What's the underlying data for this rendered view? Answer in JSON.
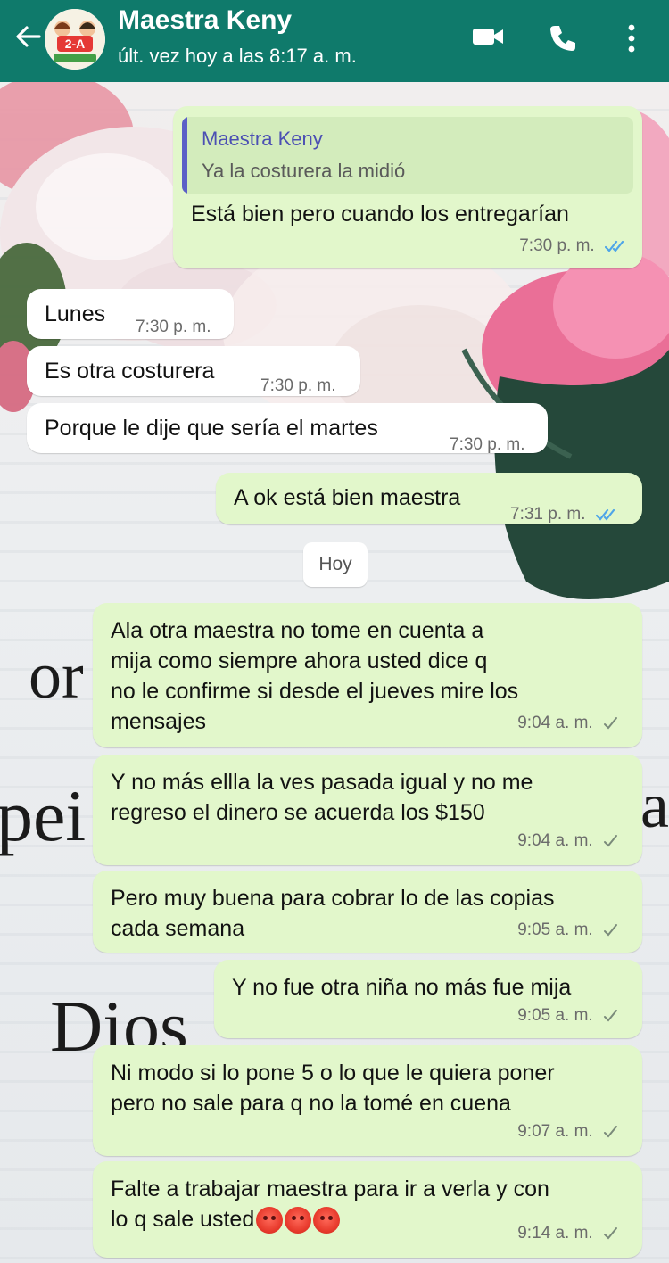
{
  "header": {
    "contact_name": "Maestra Keny",
    "last_seen": "últ. vez hoy a las 8:17 a. m.",
    "icons": [
      "back-arrow-icon",
      "video-call-icon",
      "phone-icon",
      "more-vert-icon"
    ],
    "avatar_text": "2-A"
  },
  "colors": {
    "header": "#0f7a6b",
    "outgoing_bubble": "#e2f7cb",
    "incoming_bubble": "#ffffff",
    "read_ticks": "#4fa5e8",
    "sent_tick": "#7a8a7a"
  },
  "date_chip": "Hoy",
  "messages": [
    {
      "direction": "out",
      "quote": {
        "author": "Maestra Keny",
        "text": "Ya la costurera la midió"
      },
      "lines": [
        "Está bien pero cuando los entregarían"
      ],
      "time": "7:30 p. m.",
      "status": "read"
    },
    {
      "direction": "in",
      "lines": [
        "Lunes"
      ],
      "time": "7:30 p. m."
    },
    {
      "direction": "in",
      "lines": [
        "Es otra costurera"
      ],
      "time": "7:30 p. m."
    },
    {
      "direction": "in",
      "lines": [
        "Porque le dije que sería el martes"
      ],
      "time": "7:30 p. m."
    },
    {
      "direction": "out",
      "lines": [
        "A ok está bien maestra"
      ],
      "time": "7:31 p. m.",
      "status": "read"
    },
    {
      "direction": "out",
      "lines": [
        "Ala otra maestra no tome en cuenta a",
        "mija como siempre ahora usted dice q",
        "no le confirme si desde el jueves mire los",
        "mensajes"
      ],
      "time": "9:04 a. m.",
      "status": "sent"
    },
    {
      "direction": "out",
      "lines": [
        "Y no más ellla la ves pasada igual y no me",
        "regreso el dinero se acuerda los $150"
      ],
      "time": "9:04 a. m.",
      "status": "sent"
    },
    {
      "direction": "out",
      "lines": [
        "Pero muy buena para cobrar lo de las copias",
        "cada semana"
      ],
      "time": "9:05 a. m.",
      "status": "sent"
    },
    {
      "direction": "out",
      "lines": [
        "Y no fue otra niña no más fue mija"
      ],
      "time": "9:05 a. m.",
      "status": "sent"
    },
    {
      "direction": "out",
      "lines": [
        "Ni modo si lo pone 5 o lo que le quiera poner",
        "pero no sale para q no la tomé en cuena"
      ],
      "time": "9:07 a. m.",
      "status": "sent"
    },
    {
      "direction": "out",
      "lines": [
        "Falte a trabajar maestra para ir a verla y con",
        "lo q sale usted"
      ],
      "emoji": [
        "angry-face-icon",
        "angry-face-icon",
        "angry-face-icon"
      ],
      "time": "9:14 a. m.",
      "status": "sent"
    }
  ],
  "wallpaper_words": [
    "or",
    "pei",
    "Dios",
    "a"
  ]
}
